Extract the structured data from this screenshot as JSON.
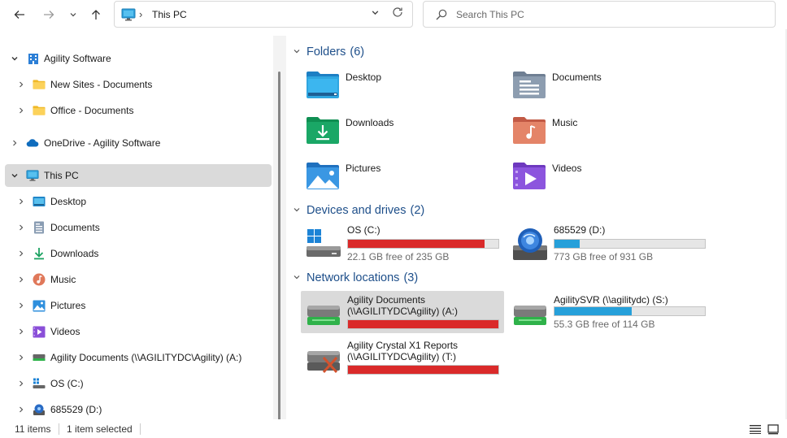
{
  "address": {
    "location": "This PC"
  },
  "search": {
    "placeholder": "Search This PC"
  },
  "sidebar": {
    "items": [
      {
        "label": "Agility Software"
      },
      {
        "label": "New Sites - Documents"
      },
      {
        "label": "Office - Documents"
      },
      {
        "label": "OneDrive - Agility Software"
      },
      {
        "label": "This PC"
      },
      {
        "label": "Desktop"
      },
      {
        "label": "Documents"
      },
      {
        "label": "Downloads"
      },
      {
        "label": "Music"
      },
      {
        "label": "Pictures"
      },
      {
        "label": "Videos"
      },
      {
        "label": "Agility Documents (\\\\AGILITYDC\\Agility) (A:)"
      },
      {
        "label": "OS (C:)"
      },
      {
        "label": "685529 (D:)"
      }
    ]
  },
  "groups": {
    "folders": {
      "title": "Folders",
      "count": "(6)"
    },
    "drives": {
      "title": "Devices and drives",
      "count": "(2)"
    },
    "network": {
      "title": "Network locations",
      "count": "(3)"
    }
  },
  "folders": [
    {
      "name": "Desktop"
    },
    {
      "name": "Documents"
    },
    {
      "name": "Downloads"
    },
    {
      "name": "Music"
    },
    {
      "name": "Pictures"
    },
    {
      "name": "Videos"
    }
  ],
  "drives": [
    {
      "name": "OS (C:)",
      "free": "22.1 GB free of 235 GB",
      "used_fraction": 0.906,
      "bar_color": "#da2a2a"
    },
    {
      "name": "685529 (D:)",
      "free": "773 GB free of 931 GB",
      "used_fraction": 0.17,
      "bar_color": "#26a0da"
    }
  ],
  "network": [
    {
      "name_line1": "Agility Documents",
      "name_line2": "(\\\\AGILITYDC\\Agility) (A:)",
      "used_fraction": 1.0,
      "bar_color": "#da2a2a"
    },
    {
      "name_line1": "AgilitySVR (\\\\agilitydc) (S:)",
      "free": "55.3 GB free of 114 GB",
      "used_fraction": 0.515,
      "bar_color": "#26a0da"
    },
    {
      "name_line1": "Agility Crystal X1 Reports",
      "name_line2": "(\\\\AGILITYDC\\Agility) (T:)",
      "used_fraction": 1.0,
      "bar_color": "#da2a2a"
    }
  ],
  "status": {
    "count": "11 items",
    "selected": "1 item selected"
  },
  "colors": {
    "accent": "#1e4f8a",
    "selection": "#dadada",
    "warn_bar": "#da2a2a",
    "normal_bar": "#26a0da"
  }
}
